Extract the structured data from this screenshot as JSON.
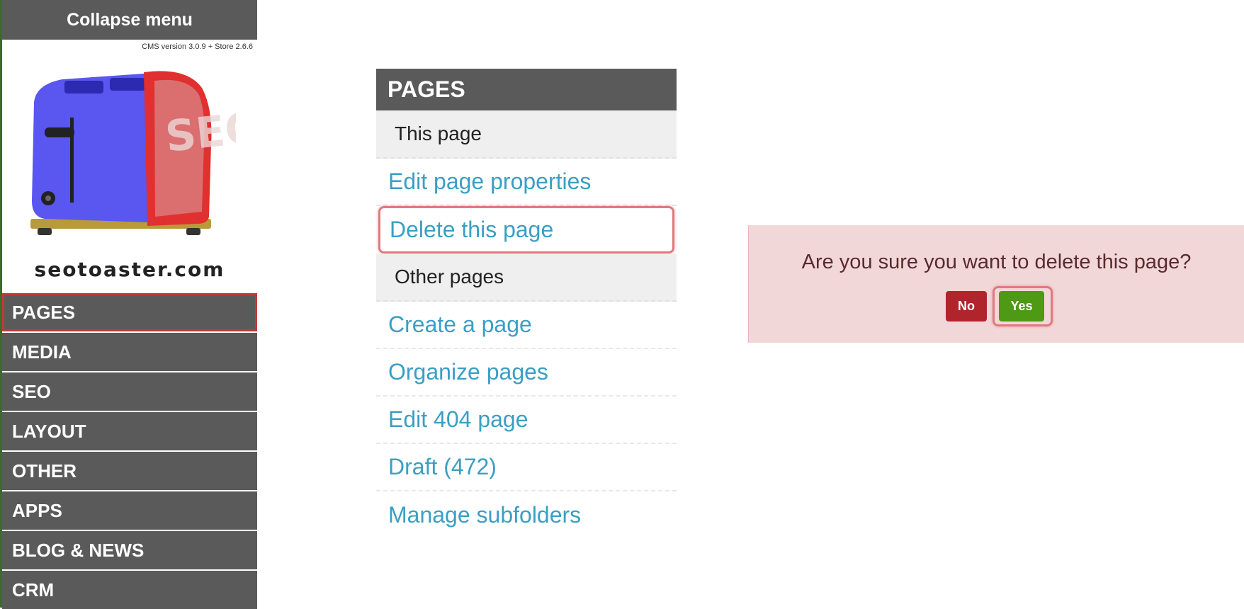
{
  "sidebar": {
    "collapse_label": "Collapse menu",
    "version": "CMS version 3.0.9 + Store 2.6.6",
    "logo_text": "SEO",
    "domain": "seotoaster.com",
    "menu": [
      {
        "label": "PAGES",
        "active": true
      },
      {
        "label": "MEDIA"
      },
      {
        "label": "SEO"
      },
      {
        "label": "LAYOUT"
      },
      {
        "label": "OTHER"
      },
      {
        "label": "APPS"
      },
      {
        "label": "BLOG & NEWS"
      },
      {
        "label": "CRM"
      }
    ]
  },
  "panel": {
    "title": "PAGES",
    "this_page": {
      "heading": "This page",
      "links": [
        "Edit page properties",
        "Delete this page"
      ]
    },
    "other_pages": {
      "heading": "Other pages",
      "links": [
        "Create a page",
        "Organize pages",
        "Edit 404 page",
        "Draft (472)",
        "Manage subfolders"
      ]
    }
  },
  "dialog": {
    "message": "Are you sure you want to delete this page?",
    "no_label": "No",
    "yes_label": "Yes"
  },
  "colors": {
    "menu_bg": "#5a5a5a",
    "link": "#3a9fc4",
    "highlight": "#e07a80",
    "dialog_bg": "#f2d7d9",
    "no_button": "#b0252b",
    "yes_button": "#4e9a14"
  }
}
